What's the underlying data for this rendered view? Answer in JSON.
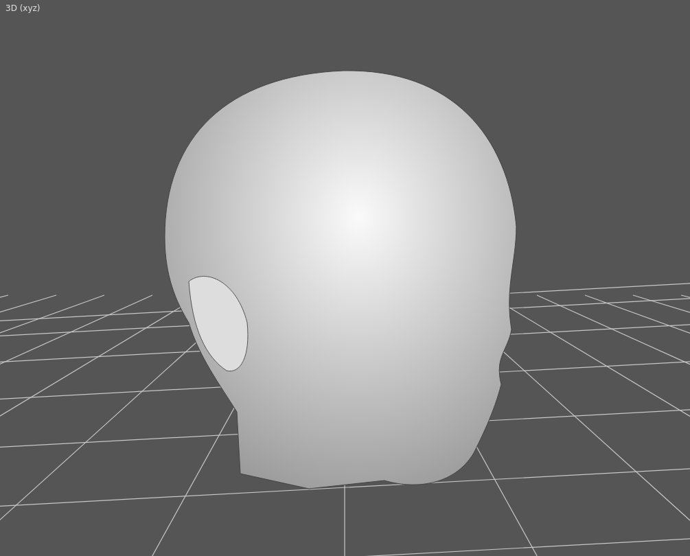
{
  "viewport": {
    "label": "3D (xyz)"
  }
}
